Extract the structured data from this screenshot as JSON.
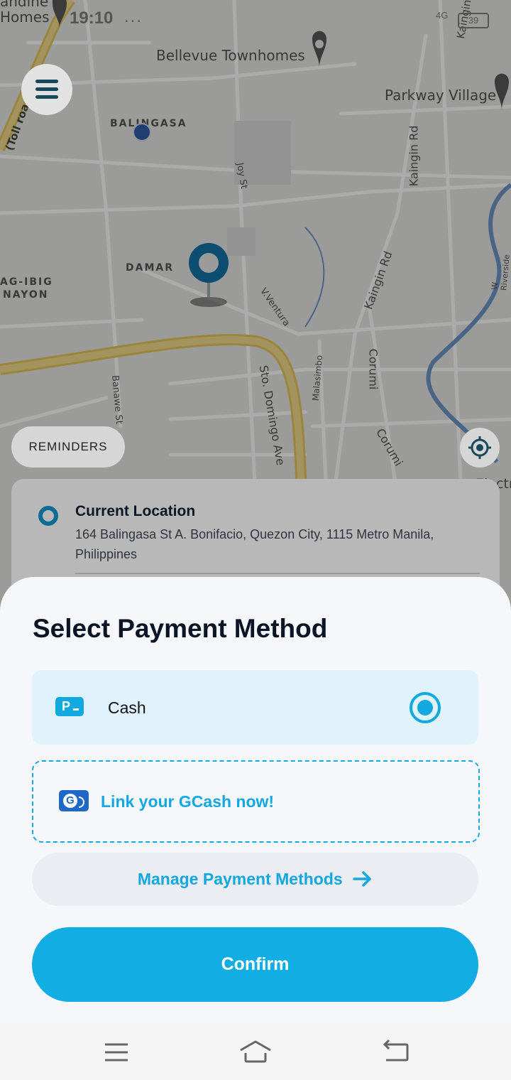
{
  "status_bar": {
    "time": "19:10",
    "dots": "...",
    "signal": "4G",
    "battery": "39"
  },
  "map": {
    "labels": {
      "bellevue": "Bellevue Townhomes",
      "parkway": "Parkway Village",
      "balingasa": "BALINGASA",
      "damar": "DAMAR",
      "pagibig": "AG-IBIG",
      "nayon": "NAYON",
      "joy_st": "Joy St",
      "kaingin_rd": "Kaingin Rd",
      "kaingin_rd2": "Kaingin Rd",
      "kaingin_top": "Kaingin",
      "vventura": "V.Ventura",
      "banawe": "Banawe St",
      "sto_domingo": "Sto. Domingo Ave",
      "malasimbo": "Malasimbo",
      "corumi": "Corumi",
      "corumi2": "Corumi",
      "w_riverside": "W Riverside",
      "toll": "(Toll roa",
      "homes": "Homes",
      "andine": "andine",
      "electr": "Electr"
    },
    "reminders_label": "REMINDERS"
  },
  "location_card": {
    "title": "Current Location",
    "address": "164 Balingasa St A. Bonifacio, Quezon City, 1115 Metro Manila, Philippines"
  },
  "payment_sheet": {
    "title": "Select Payment Method",
    "cash_label": "Cash",
    "cash_icon_glyph": "P",
    "gcash_label": "Link your GCash now!",
    "gcash_icon_glyph": "G",
    "manage_label": "Manage Payment Methods",
    "confirm_label": "Confirm"
  },
  "colors": {
    "accent": "#12ade3",
    "dark_text": "#0b1525"
  }
}
